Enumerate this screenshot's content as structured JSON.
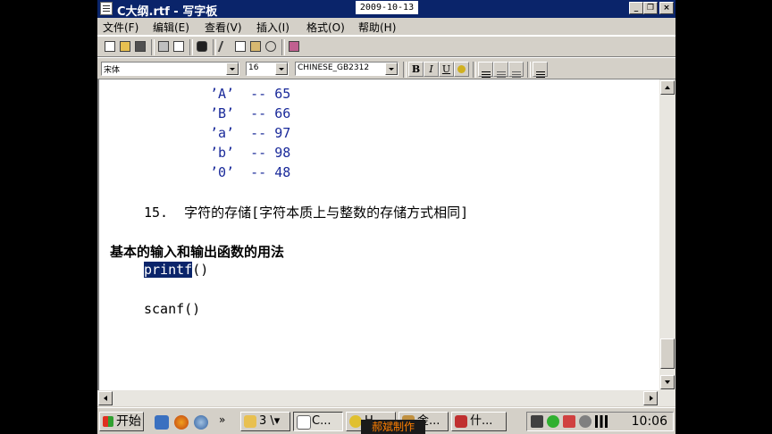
{
  "window": {
    "title": "C大纲.rtf - 写字板",
    "date": "2009-10-13",
    "minimize": "_",
    "restore": "❐",
    "close": "×"
  },
  "menu": [
    "文件(F)",
    "编辑(E)",
    "查看(V)",
    "插入(I)",
    "格式(O)",
    "帮助(H)"
  ],
  "format": {
    "font": "宋体",
    "size": "16",
    "script": "CHINESE_GB2312",
    "bold": "B",
    "italic": "I",
    "underline": "U"
  },
  "document": {
    "ascii_rows": [
      "’A’  -- 65",
      "’B’  -- 66",
      "’a’  -- 97",
      "’b’  -- 98",
      "’0’  -- 48"
    ],
    "item15": "15.  字符的存储[字符本质上与整数的存储方式相同]",
    "heading": "基本的输入和输出函数的用法",
    "printf_sel": "printf",
    "printf_rest": "()",
    "scanf": "scanf()"
  },
  "taskbar": {
    "start": "开始",
    "group_count": "3",
    "tasks": [
      "C...",
      "H...",
      "金...",
      "什..."
    ],
    "clock": "10:06",
    "watermark": "郝斌制作"
  },
  "colors": {
    "titlebar": "#0a246a",
    "ascii_text": "#1a2a9a",
    "selection": "#0a246a"
  }
}
